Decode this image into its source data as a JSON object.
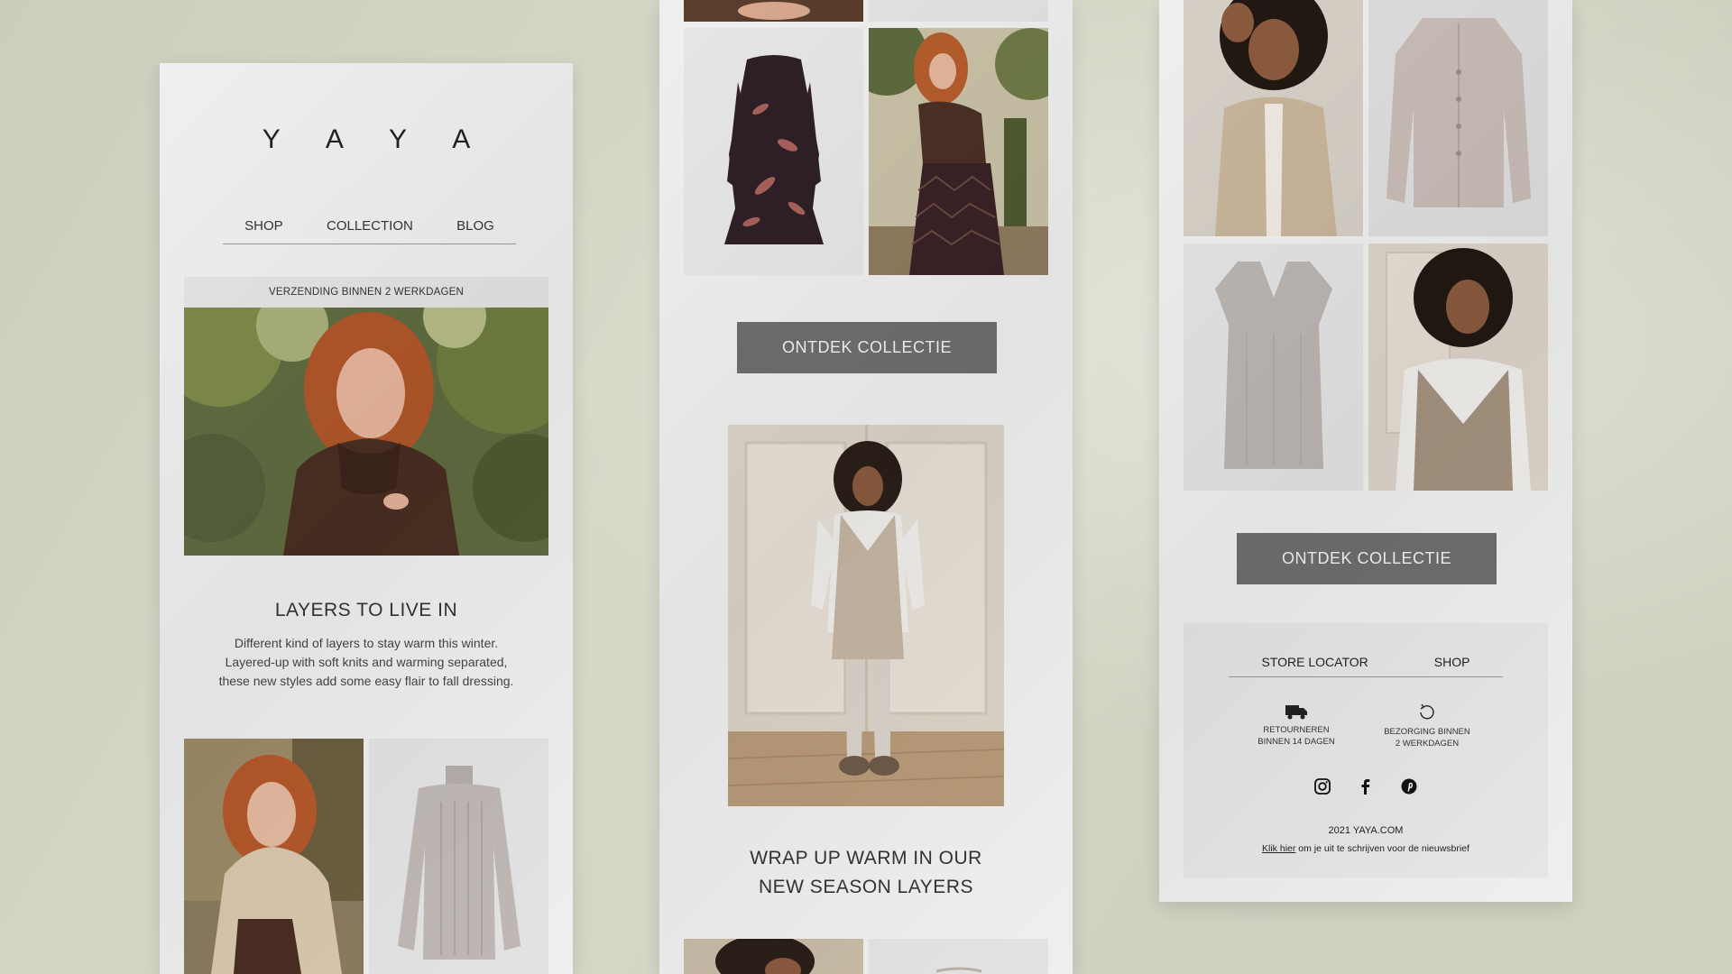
{
  "newsletter": {
    "brand_logo": "Y A Y A",
    "nav": {
      "shop": "SHOP",
      "collection": "COLLECTION",
      "blog": "BLOG"
    },
    "shipping_banner": "VERZENDING BINNEN 2 WERKDAGEN",
    "hero_heading": "LAYERS TO LIVE IN",
    "hero_text": [
      "Different kind of layers to stay warm this winter.",
      "Layered-up with soft knits and warming separated,",
      "these new styles add some easy flair to fall dressing."
    ],
    "cta_label": "ONTDEK COLLECTIE",
    "section2_heading": [
      "WRAP UP WARM IN OUR",
      "NEW SEASON LAYERS"
    ],
    "footer": {
      "nav": {
        "store_locator": "STORE LOCATOR",
        "shop": "SHOP"
      },
      "returns": [
        "RETOURNEREN",
        "BINNEN 14 DAGEN"
      ],
      "delivery": [
        "BEZORGING BINNEN",
        "2 WERKDAGEN"
      ],
      "social": [
        "instagram-icon",
        "facebook-icon",
        "pinterest-icon"
      ],
      "copyright": "2021 YAYA.COM",
      "unsubscribe_link": "Klik hier",
      "unsubscribe_text": " om je uit te schrijven voor de nieuwsbrief"
    }
  },
  "colors": {
    "background": "#d8d8c8",
    "panel": "#efefef",
    "button": "#6e6e6e",
    "footer": "#e6e6e6"
  }
}
